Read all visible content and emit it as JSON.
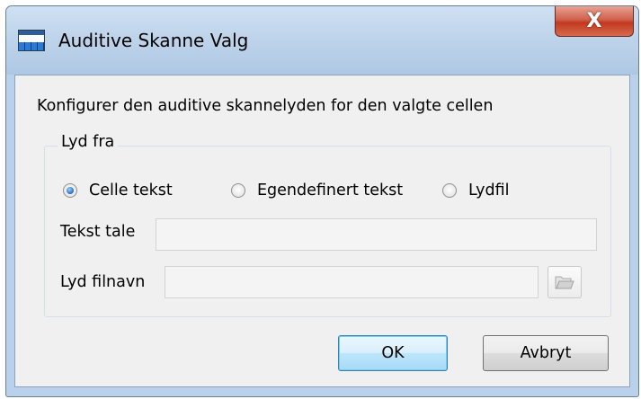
{
  "window": {
    "title": "Auditive Skanne Valg",
    "close_label": "X"
  },
  "description": "Konfigurer den auditive skannelyden for den valgte cellen",
  "sound_group": {
    "label": "Lyd fra",
    "options": [
      {
        "label": "Celle tekst",
        "checked": true
      },
      {
        "label": "Egendefinert tekst",
        "checked": false
      },
      {
        "label": "Lydfil",
        "checked": false
      }
    ]
  },
  "fields": {
    "speech_text": {
      "label": "Tekst tale",
      "value": ""
    },
    "sound_file": {
      "label": "Lyd filnavn",
      "value": ""
    }
  },
  "buttons": {
    "ok": "OK",
    "cancel": "Avbryt"
  },
  "icons": {
    "app": "grid-window-icon",
    "browse": "open-folder-icon",
    "close": "close-icon"
  },
  "colors": {
    "frame": "#b9d1ea",
    "close_button": "#c2391f",
    "client_bg": "#f0f0f0",
    "default_button_border": "#3c7fb1",
    "radio_checked": "#1f6fbf"
  }
}
